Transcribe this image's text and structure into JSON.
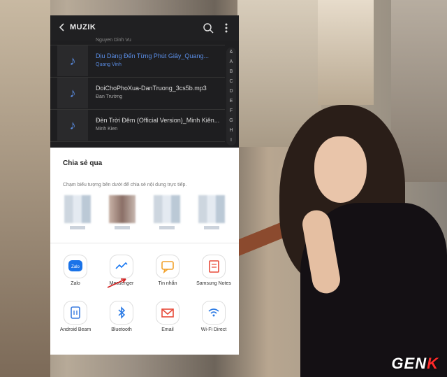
{
  "topbar": {
    "title": "MUZIK"
  },
  "list": {
    "partial_artist": "Nguyen Dinh Vu",
    "songs": [
      {
        "title": "Dịu Dàng Đến Từng Phút Giây_Quang...",
        "artist": "Quang Vinh",
        "active": true
      },
      {
        "title": "DoiChoPhoXua-DanTruong_3cs5b.mp3",
        "artist": "Đan Trường",
        "active": false
      },
      {
        "title": "Đèn Trời Đêm (Official Version)_Minh Kiên...",
        "artist": "Minh Kien",
        "active": false
      }
    ]
  },
  "index_letters": [
    "&",
    "A",
    "B",
    "C",
    "D",
    "E",
    "F",
    "G",
    "H",
    "I"
  ],
  "share": {
    "title": "Chia sẻ qua",
    "subtitle": "Chạm biểu tượng bên dưới để chia sẻ nội dung trực tiếp.",
    "apps": [
      {
        "label": "Zalo",
        "icon": "zalo-icon",
        "glyph": "Zalo",
        "color": "#1a73e8"
      },
      {
        "label": "Messenger",
        "icon": "messenger-icon",
        "glyph": "",
        "color": "#1877f2"
      },
      {
        "label": "Tin nhắn",
        "icon": "messages-icon",
        "glyph": "",
        "color": "#f2a12b"
      },
      {
        "label": "Samsung Notes",
        "icon": "notes-icon",
        "glyph": "",
        "color": "#e84b3a"
      },
      {
        "label": "Android Beam",
        "icon": "android-beam-icon",
        "glyph": "",
        "color": "#3b7de0"
      },
      {
        "label": "Bluetooth",
        "icon": "bluetooth-icon",
        "glyph": "",
        "color": "#2c7be5"
      },
      {
        "label": "Email",
        "icon": "email-icon",
        "glyph": "",
        "color": "#e84b3a"
      },
      {
        "label": "Wi-Fi Direct",
        "icon": "wifi-direct-icon",
        "glyph": "",
        "color": "#2c7be5"
      }
    ]
  },
  "watermark": "GENK"
}
